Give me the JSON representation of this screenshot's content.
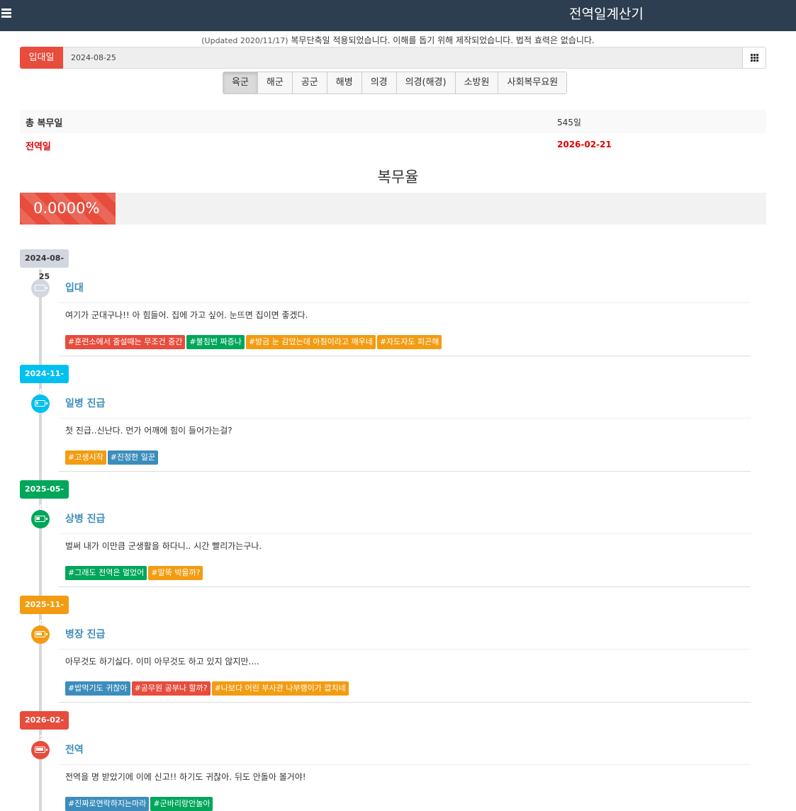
{
  "app": {
    "title": "전역일계산기"
  },
  "notice": {
    "prefix": "(Updated 2020/11/17)",
    "text": " 복무단축일 적용되었습니다. 이해를 돕기 위해 제작되었습니다. 법적 효력은 없습니다."
  },
  "enlist": {
    "label": "입대일",
    "value": "2024-08-25"
  },
  "branches": [
    "육군",
    "해군",
    "공군",
    "해병",
    "의경",
    "의경(해경)",
    "소방원",
    "사회복무요원"
  ],
  "selected_branch": "육군",
  "summary": {
    "total_label": "총 복무일",
    "total_value": "545일",
    "discharge_label": "전역일",
    "discharge_value": "2026-02-21"
  },
  "rate": {
    "title": "복무율",
    "value": "0.0000%",
    "fraction": 0.0
  },
  "colors": {
    "red": "#e74c3c",
    "blue": "#3c8dbc",
    "green": "#00a65a",
    "orange": "#f39c12",
    "aqua": "#00c0ef",
    "gray": "#d2d6de"
  },
  "timeline": [
    {
      "date": "2024-08-25",
      "title": "입대",
      "body": "여기가 군대구나!! 아 힘들어. 집에 가고 싶어. 눈뜨면 집이면 좋겠다.",
      "badge_color": "#d2d6de",
      "icon": "battery-empty-icon",
      "battery": 0,
      "tags": [
        {
          "text": "#훈련소에서 줄설때는 무조건 중간",
          "color": "#e74c3c"
        },
        {
          "text": "#불침번 짜증나",
          "color": "#00a65a"
        },
        {
          "text": "#방금 눈 감았는데 아침이라고 깨우네",
          "color": "#f39c12"
        },
        {
          "text": "#자도자도 피곤해",
          "color": "#f39c12"
        }
      ]
    },
    {
      "date": "2024-11-01",
      "title": "일병 진급",
      "body": "첫 진급..신난다. 먼가 어깨에 힘이 들어가는걸?",
      "badge_color": "#00c0ef",
      "icon": "battery-quarter-icon",
      "battery": 0.25,
      "tags": [
        {
          "text": "#고생시작",
          "color": "#f39c12"
        },
        {
          "text": "#진정한 일꾼",
          "color": "#3c8dbc"
        }
      ]
    },
    {
      "date": "2025-05-01",
      "title": "상병 진급",
      "body": "벌써 내가 이만큼 군생활을 하다니.. 시간 빨리가는구나.",
      "badge_color": "#00a65a",
      "icon": "battery-half-icon",
      "battery": 0.5,
      "tags": [
        {
          "text": "#그래도 전역은 멀었어",
          "color": "#00a65a"
        },
        {
          "text": "#말뚝 박을까?",
          "color": "#f39c12"
        }
      ]
    },
    {
      "date": "2025-11-01",
      "title": "병장 진급",
      "body": "아무것도 하기싫다. 이미 아무것도 하고 있지 않지만....",
      "badge_color": "#f39c12",
      "icon": "battery-three-quarters-icon",
      "battery": 0.75,
      "tags": [
        {
          "text": "#밥먹기도 귀찮아",
          "color": "#3c8dbc"
        },
        {
          "text": "#공무원 공부나 할까?",
          "color": "#e74c3c"
        },
        {
          "text": "#나보다 어린 부사관 나부랭이가 깝치네",
          "color": "#f39c12"
        }
      ]
    },
    {
      "date": "2026-02-21",
      "title": "전역",
      "body": "전역을 명 받았기에 이에 신고!! 하기도 귀찮아. 뒤도 안돌아 볼거야!",
      "badge_color": "#e74c3c",
      "icon": "battery-full-icon",
      "battery": 1,
      "tags": [
        {
          "text": "#진짜로연락하지는마라",
          "color": "#3c8dbc"
        },
        {
          "text": "#군바리랑안놀아",
          "color": "#00a65a"
        }
      ]
    }
  ]
}
